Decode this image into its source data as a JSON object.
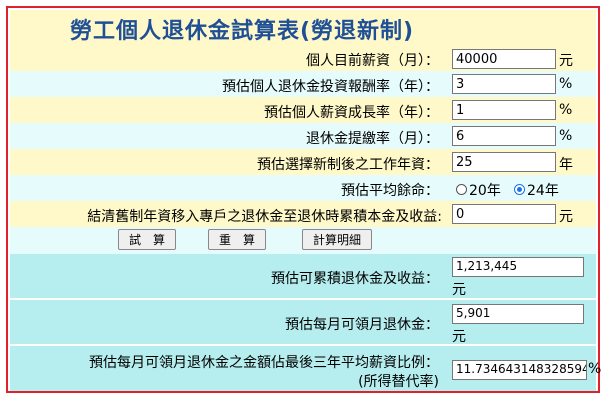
{
  "title": "勞工個人退休金試算表(勞退新制)",
  "fields": [
    {
      "label": "個人目前薪資（月）：",
      "value": "40000",
      "unit": "元"
    },
    {
      "label": "預估個人退休金投資報酬率（年）：",
      "value": "3",
      "unit": "%"
    },
    {
      "label": "預估個人薪資成長率（年）：",
      "value": "1",
      "unit": "%"
    },
    {
      "label": "退休金提繳率（月）：",
      "value": "6",
      "unit": "%"
    },
    {
      "label": "預估選擇新制後之工作年資：",
      "value": "25",
      "unit": "年"
    }
  ],
  "life_expectancy": {
    "label": "預估平均餘命：",
    "options": [
      "20年",
      "24年"
    ],
    "selected": "24年"
  },
  "transfer": {
    "label": "結清舊制年資移入專戶之退休金至退休時累積本金及收益:",
    "value": "0",
    "unit": "元"
  },
  "buttons": {
    "calc": "試　算",
    "reset": "重　算",
    "detail": "計算明細"
  },
  "results": {
    "accumulated_label": "預估可累積退休金及收益：",
    "accumulated_value": "1,213,445",
    "accumulated_unit": "元",
    "monthly_label": "預估每月可領月退休金：",
    "monthly_value": "5,901",
    "monthly_unit": "元",
    "ratio_label": "預估每月可領月退休金之金額佔最後三年平均薪資比例：",
    "ratio_sublabel": "(所得替代率)",
    "ratio_value": "11.734643148328594",
    "ratio_unit": "%"
  },
  "colors": {
    "border": "#e0202a",
    "title": "#1f4f96",
    "yellow": "#fff9c9",
    "cyan": "#e6fcfc",
    "teal": "#b6eef0"
  }
}
